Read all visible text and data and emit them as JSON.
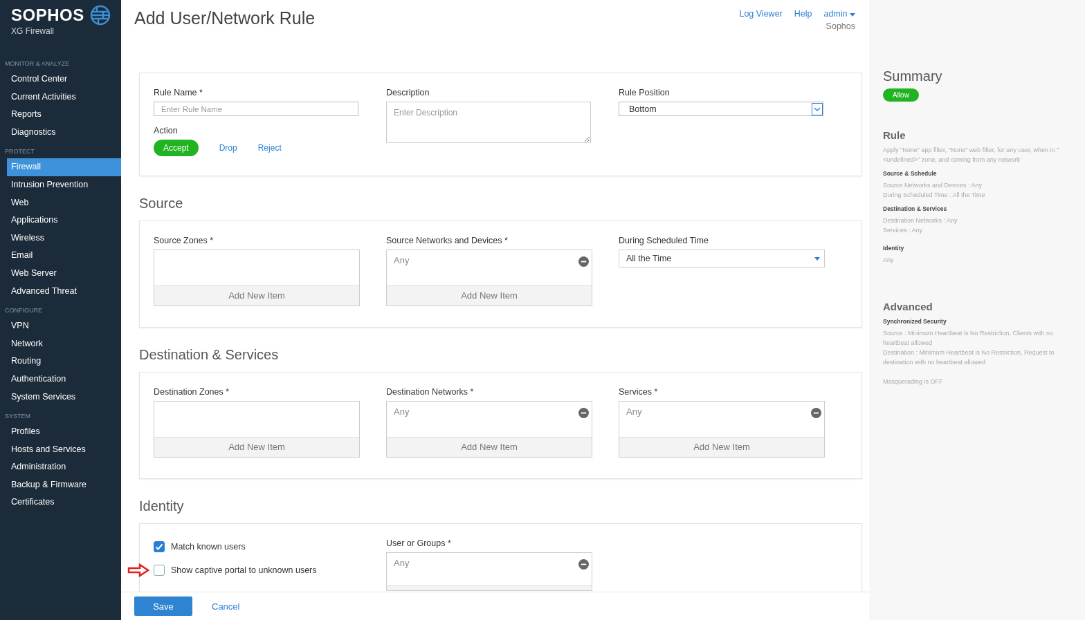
{
  "sidebar": {
    "brand": "SOPHOS",
    "product": "XG Firewall",
    "groups": [
      {
        "heading": "MONITOR & ANALYZE",
        "items": [
          {
            "label": "Control Center",
            "selected": false
          },
          {
            "label": "Current Activities",
            "selected": false
          },
          {
            "label": "Reports",
            "selected": false
          },
          {
            "label": "Diagnostics",
            "selected": false
          }
        ]
      },
      {
        "heading": "PROTECT",
        "items": [
          {
            "label": "Firewall",
            "selected": true
          },
          {
            "label": "Intrusion Prevention",
            "selected": false
          },
          {
            "label": "Web",
            "selected": false
          },
          {
            "label": "Applications",
            "selected": false
          },
          {
            "label": "Wireless",
            "selected": false
          },
          {
            "label": "Email",
            "selected": false
          },
          {
            "label": "Web Server",
            "selected": false
          },
          {
            "label": "Advanced Threat",
            "selected": false
          }
        ]
      },
      {
        "heading": "CONFIGURE",
        "items": [
          {
            "label": "VPN",
            "selected": false
          },
          {
            "label": "Network",
            "selected": false
          },
          {
            "label": "Routing",
            "selected": false
          },
          {
            "label": "Authentication",
            "selected": false
          },
          {
            "label": "System Services",
            "selected": false
          }
        ]
      },
      {
        "heading": "SYSTEM",
        "items": [
          {
            "label": "Profiles",
            "selected": false
          },
          {
            "label": "Hosts and Services",
            "selected": false
          },
          {
            "label": "Administration",
            "selected": false
          },
          {
            "label": "Backup & Firmware",
            "selected": false
          },
          {
            "label": "Certificates",
            "selected": false
          }
        ]
      }
    ]
  },
  "header": {
    "title": "Add User/Network Rule",
    "links": [
      "Log Viewer",
      "Help"
    ],
    "user": "admin",
    "organization": "Sophos"
  },
  "general": {
    "rule_name": {
      "label": "Rule Name *",
      "placeholder": "Enter Rule Name"
    },
    "description": {
      "label": "Description",
      "placeholder": "Enter Description"
    },
    "rule_position": {
      "label": "Rule Position",
      "value": "Bottom"
    },
    "action": {
      "label": "Action",
      "options": [
        {
          "label": "Accept",
          "selected": true
        },
        {
          "label": "Drop",
          "selected": false
        },
        {
          "label": "Reject",
          "selected": false
        }
      ]
    }
  },
  "sections": [
    {
      "title": "Source",
      "fields": [
        {
          "kind": "list",
          "label": "Source Zones *",
          "add_label": "Add New Item"
        },
        {
          "kind": "list",
          "label": "Source Networks and Devices *",
          "items": [
            "Any"
          ],
          "add_label": "Add New Item"
        },
        {
          "kind": "select",
          "label": "During Scheduled Time",
          "value": "All the Time"
        }
      ]
    },
    {
      "title": "Destination & Services",
      "fields": [
        {
          "kind": "list",
          "label": "Destination Zones *",
          "add_label": "Add New Item"
        },
        {
          "kind": "list",
          "label": "Destination Networks *",
          "items": [
            "Any"
          ],
          "add_label": "Add New Item"
        },
        {
          "kind": "list",
          "label": "Services *",
          "items": [
            "Any"
          ],
          "add_label": "Add New Item"
        }
      ]
    }
  ],
  "identity": {
    "title": "Identity",
    "options": [
      {
        "label": "Match known users",
        "checked": true,
        "highlighted": false
      },
      {
        "label": "Show captive portal to unknown users",
        "checked": false,
        "highlighted": true
      }
    ],
    "user_groups": {
      "label": "User or Groups *",
      "items": [
        "Any"
      ]
    }
  },
  "footer": {
    "save": "Save",
    "cancel": "Cancel"
  },
  "summary": {
    "title": "Summary",
    "badge": "Allow",
    "blocks": [
      {
        "title": "Rule",
        "intro": "Apply \"None\" app filter, \"None\" web filter, for any user, when in \"<undefined>\" zone, and coming from any network",
        "parts": [
          {
            "heading": "Source & Schedule",
            "lines": [
              "Source Networks and Devices : Any",
              "During Scheduled Time : All the Time"
            ]
          },
          {
            "heading": "Destination & Services",
            "lines": [
              "Destination Networks : Any",
              "Services : Any"
            ]
          },
          {
            "heading": "Identity",
            "lines": [
              "Any"
            ]
          }
        ]
      },
      {
        "title": "Advanced",
        "parts": [
          {
            "heading": "Synchronized Security",
            "lines": [
              "Source : Minimum Heartbeat is No Restriction, Clients with no heartbeat allowed",
              "Destination : Minimum Heartbeat is No Restriction, Request to destination with no heartbeat allowed"
            ]
          },
          {
            "lines": [
              "Masquerading is OFF"
            ]
          }
        ]
      }
    ]
  }
}
